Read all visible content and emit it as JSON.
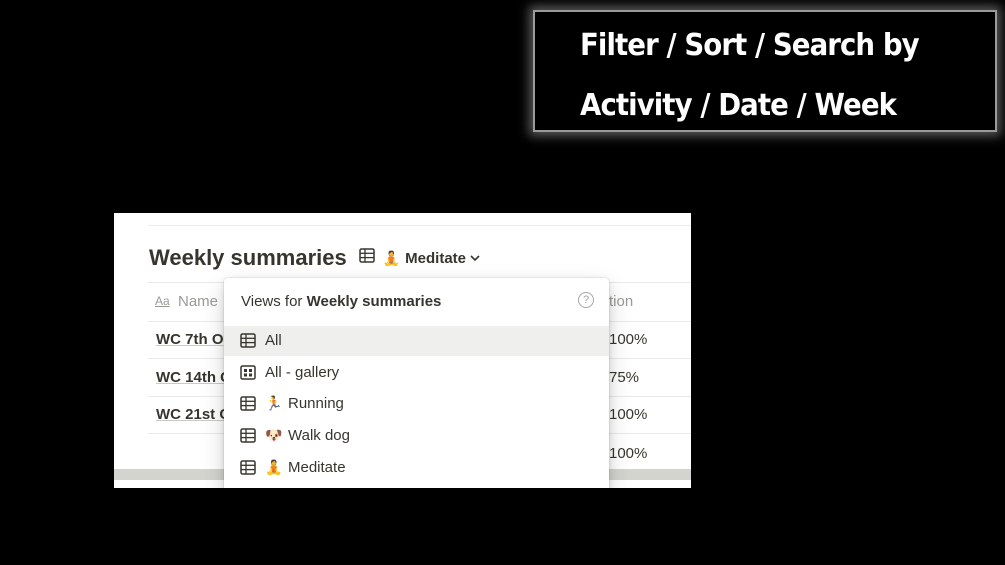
{
  "callout": {
    "line1": "Filter / Sort / Search by",
    "line2": "Activity / Date / Week"
  },
  "database": {
    "title": "Weekly summaries",
    "current_view": {
      "emoji": "🧘",
      "label": "Meditate",
      "icon": "table-icon"
    },
    "columns": [
      {
        "icon": "Aa",
        "label": "Name"
      },
      {
        "label": "tion"
      }
    ],
    "rows": [
      {
        "name": "WC 7th O",
        "value": "100%"
      },
      {
        "name": "WC 14th C",
        "value": "75%"
      },
      {
        "name": "WC 21st C",
        "value": "100%"
      },
      {
        "name": "",
        "value": "100%"
      }
    ]
  },
  "views_menu": {
    "prefix": "Views for ",
    "db_name": "Weekly summaries",
    "help_icon": "?",
    "items": [
      {
        "icon": "table-icon",
        "emoji": "",
        "label": "All",
        "selected": true
      },
      {
        "icon": "gallery-icon",
        "emoji": "",
        "label": "All - gallery",
        "selected": false
      },
      {
        "icon": "table-icon",
        "emoji": "🏃",
        "label": "Running",
        "selected": false
      },
      {
        "icon": "table-icon",
        "emoji": "🐶",
        "label": "Walk dog",
        "selected": false
      },
      {
        "icon": "table-icon",
        "emoji": "🧘",
        "label": "Meditate",
        "selected": false
      }
    ]
  }
}
